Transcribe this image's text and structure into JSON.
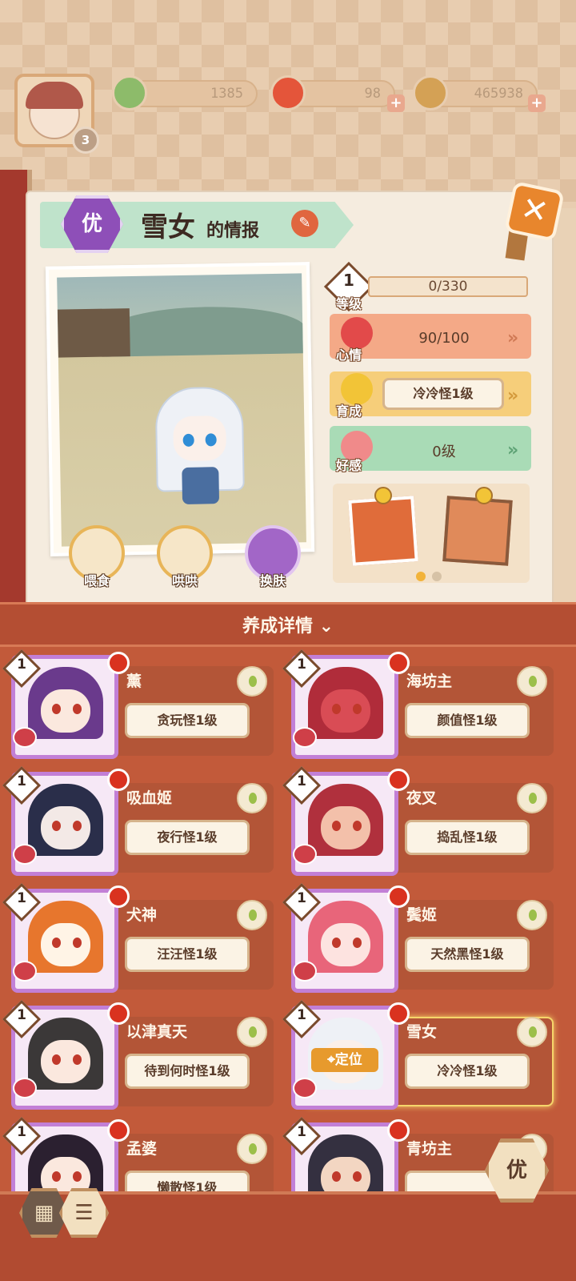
{
  "resources": {
    "player_level": "3",
    "pine": "1385",
    "nine": "98",
    "coins": "465938"
  },
  "info": {
    "quality": "优",
    "name": "雪女",
    "title_suffix": "的情报"
  },
  "actions": [
    {
      "label": "喂食"
    },
    {
      "label": "哄哄"
    },
    {
      "label": "换肤"
    }
  ],
  "stats": {
    "level": "1",
    "level_label": "等级",
    "exp": "0/330",
    "mood_label": "心情",
    "mood": "90/100",
    "growth_label": "育成",
    "growth": "冷冷怪1级",
    "affection_label": "好感",
    "affection": "0级"
  },
  "section_title": "养成详情 ⌄",
  "cards": [
    {
      "name": "薰",
      "status": "贪玩怪1级",
      "level": "1",
      "hair": "#6a3a8c",
      "skin": "#fbe8de"
    },
    {
      "name": "海坊主",
      "status": "颜值怪1级",
      "level": "1",
      "hair": "#b02c3a",
      "skin": "#d94c55"
    },
    {
      "name": "吸血姬",
      "status": "夜行怪1级",
      "level": "1",
      "hair": "#2a2e4a",
      "skin": "#f3e9e6"
    },
    {
      "name": "夜叉",
      "status": "捣乱怪1级",
      "level": "1",
      "hair": "#b0303d",
      "skin": "#f3c0aa"
    },
    {
      "name": "犬神",
      "status": "汪汪怪1级",
      "level": "1",
      "hair": "#e7762d",
      "skin": "#fff4e6"
    },
    {
      "name": "鬓姬",
      "status": "天然黑怪1级",
      "level": "1",
      "hair": "#e8657a",
      "skin": "#fde3e0"
    },
    {
      "name": "以津真天",
      "status": "待到何时怪1级",
      "level": "1",
      "hair": "#3b3838",
      "skin": "#fbe8de"
    },
    {
      "name": "雪女",
      "status": "冷冷怪1级",
      "level": "1",
      "hair": "#eef1f6",
      "skin": "#fbf0ea",
      "selected": true,
      "locate": "定位"
    },
    {
      "name": "孟婆",
      "status": "懒散怪1级",
      "level": "1",
      "hair": "#2b2030",
      "skin": "#fbe8de"
    },
    {
      "name": "青坊主",
      "status": "",
      "level": "1",
      "hair": "#343040",
      "skin": "#f3d6c2"
    }
  ],
  "filter_label": "优"
}
